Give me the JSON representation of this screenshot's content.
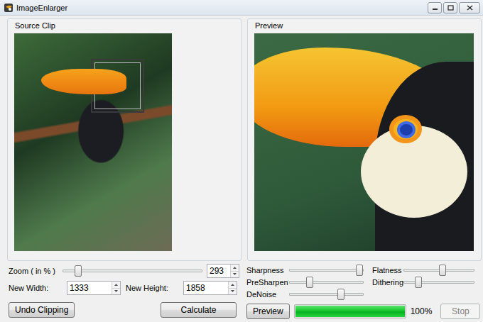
{
  "window": {
    "title": "ImageEnlarger"
  },
  "source": {
    "title": "Source Clip"
  },
  "preview": {
    "title": "Preview"
  },
  "zoom": {
    "label": "Zoom ( in % )",
    "level": 0.11,
    "value": "293"
  },
  "size": {
    "width_label": "New Width:",
    "width": "1333",
    "height_label": "New Height:",
    "height": "1858"
  },
  "undo_button": "Undo Clipping",
  "calculate_button": "Calculate",
  "sliders": [
    {
      "label": "Sharpness",
      "level": 0.95
    },
    {
      "label": "Flatness",
      "level": 0.55
    },
    {
      "label": "PreSharpen",
      "level": 0.27
    },
    {
      "label": "Dithering",
      "level": 0.2
    },
    {
      "label": "DeNoise",
      "level": 0.7
    }
  ],
  "preview_button": "Preview",
  "progress": {
    "level": 1,
    "reading": "100%"
  },
  "stop_button": {
    "label": "Stop",
    "disabled": true
  }
}
